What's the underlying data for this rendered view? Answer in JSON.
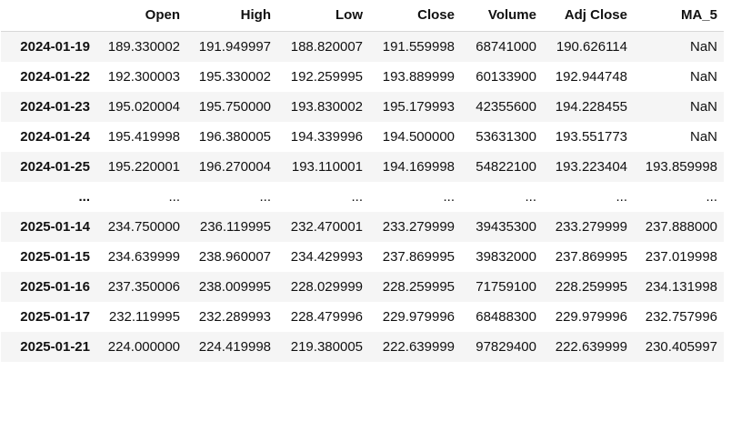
{
  "table": {
    "columns": [
      "Open",
      "High",
      "Low",
      "Close",
      "Volume",
      "Adj Close",
      "MA_5"
    ],
    "rows": [
      {
        "index": "2024-01-19",
        "open": "189.330002",
        "high": "191.949997",
        "low": "188.820007",
        "close": "191.559998",
        "volume": "68741000",
        "adj_close": "190.626114",
        "ma_5": "NaN"
      },
      {
        "index": "2024-01-22",
        "open": "192.300003",
        "high": "195.330002",
        "low": "192.259995",
        "close": "193.889999",
        "volume": "60133900",
        "adj_close": "192.944748",
        "ma_5": "NaN"
      },
      {
        "index": "2024-01-23",
        "open": "195.020004",
        "high": "195.750000",
        "low": "193.830002",
        "close": "195.179993",
        "volume": "42355600",
        "adj_close": "194.228455",
        "ma_5": "NaN"
      },
      {
        "index": "2024-01-24",
        "open": "195.419998",
        "high": "196.380005",
        "low": "194.339996",
        "close": "194.500000",
        "volume": "53631300",
        "adj_close": "193.551773",
        "ma_5": "NaN"
      },
      {
        "index": "2024-01-25",
        "open": "195.220001",
        "high": "196.270004",
        "low": "193.110001",
        "close": "194.169998",
        "volume": "54822100",
        "adj_close": "193.223404",
        "ma_5": "193.859998"
      },
      {
        "index": "...",
        "open": "...",
        "high": "...",
        "low": "...",
        "close": "...",
        "volume": "...",
        "adj_close": "...",
        "ma_5": "..."
      },
      {
        "index": "2025-01-14",
        "open": "234.750000",
        "high": "236.119995",
        "low": "232.470001",
        "close": "233.279999",
        "volume": "39435300",
        "adj_close": "233.279999",
        "ma_5": "237.888000"
      },
      {
        "index": "2025-01-15",
        "open": "234.639999",
        "high": "238.960007",
        "low": "234.429993",
        "close": "237.869995",
        "volume": "39832000",
        "adj_close": "237.869995",
        "ma_5": "237.019998"
      },
      {
        "index": "2025-01-16",
        "open": "237.350006",
        "high": "238.009995",
        "low": "228.029999",
        "close": "228.259995",
        "volume": "71759100",
        "adj_close": "228.259995",
        "ma_5": "234.131998"
      },
      {
        "index": "2025-01-17",
        "open": "232.119995",
        "high": "232.289993",
        "low": "228.479996",
        "close": "229.979996",
        "volume": "68488300",
        "adj_close": "229.979996",
        "ma_5": "232.757996"
      },
      {
        "index": "2025-01-21",
        "open": "224.000000",
        "high": "224.419998",
        "low": "219.380005",
        "close": "222.639999",
        "volume": "97829400",
        "adj_close": "222.639999",
        "ma_5": "230.405997"
      }
    ]
  }
}
